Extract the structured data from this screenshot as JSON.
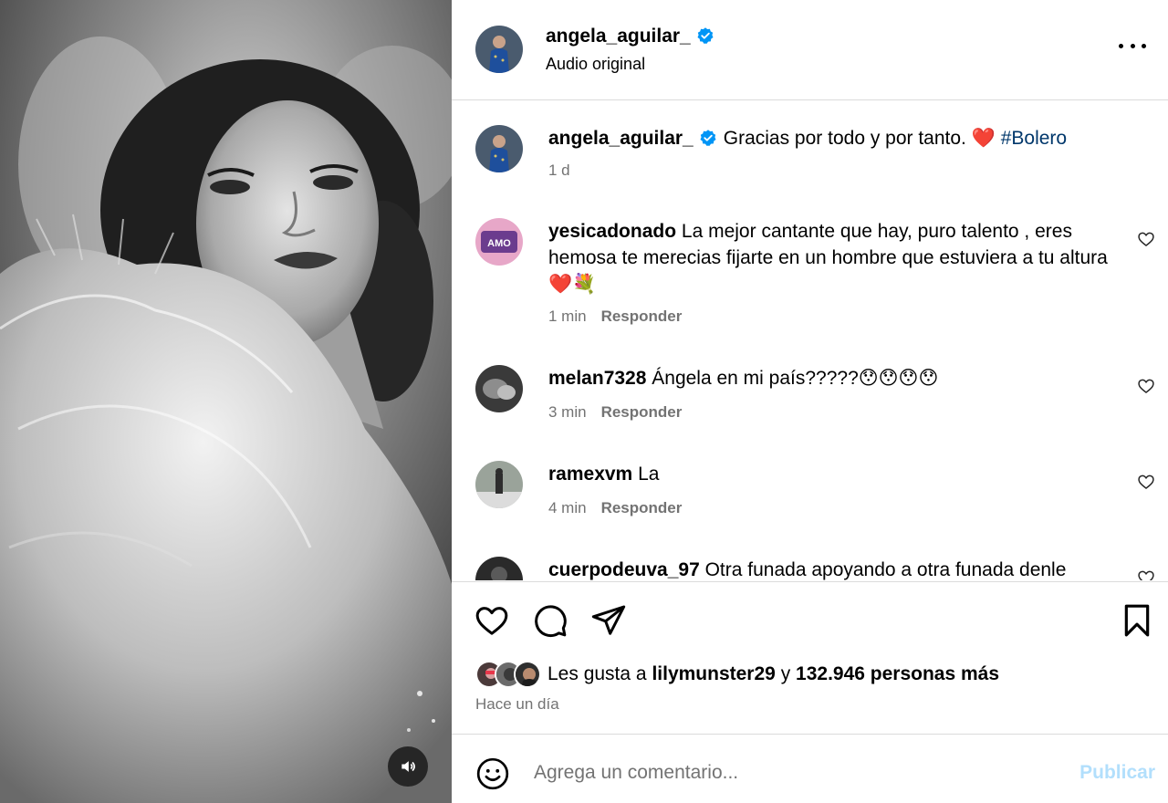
{
  "post": {
    "username": "angela_aguilar_",
    "audio": "Audio original",
    "caption": "Gracias por todo y por tanto. ❤️",
    "hashtag": "#Bolero",
    "age": "1 d"
  },
  "comments": [
    {
      "username": "yesicadonado",
      "text": "La mejor cantante que hay, puro talento , eres hemosa te merecias fijarte en un hombre que estuviera a tu altura ❤️💐",
      "time": "1 min",
      "reply": "Responder"
    },
    {
      "username": "melan7328",
      "text": "Ángela en mi país?????😯😯😯😯",
      "time": "3 min",
      "reply": "Responder"
    },
    {
      "username": "ramexvm",
      "text": "La",
      "time": "4 min",
      "reply": "Responder"
    },
    {
      "username": "cuerpodeuva_97",
      "text": "Otra funada apoyando a otra funada denle"
    }
  ],
  "likes": {
    "prefix": "Les gusta a",
    "user": "lilymunster29",
    "joiner": "y",
    "others": "132.946 personas más"
  },
  "posted_when": "Hace un día",
  "compose": {
    "placeholder": "Agrega un comentario...",
    "publish": "Publicar"
  },
  "colors": {
    "verified": "#0095f6",
    "hashtag": "#00376b",
    "muted": "#737373",
    "publish_disabled": "#b2dffc"
  }
}
